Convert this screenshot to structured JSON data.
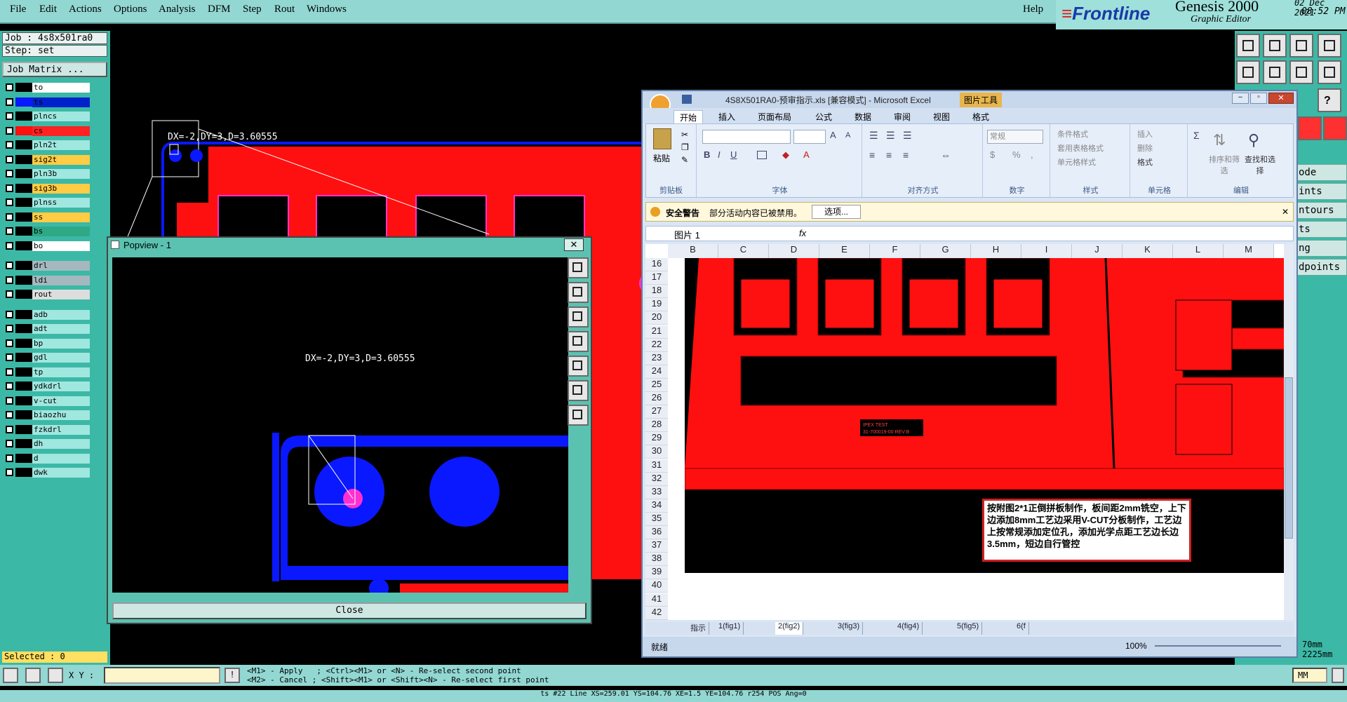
{
  "menu": [
    "File",
    "Edit",
    "Actions",
    "Options",
    "Analysis",
    "DFM",
    "Step",
    "Rout",
    "Windows",
    "Help"
  ],
  "brand": {
    "logo": "Frontline",
    "product": "Genesis 2000",
    "subtitle": "Graphic Editor",
    "date": "02 Dec 2021",
    "time": "08:52 PM"
  },
  "job": {
    "job_label": "Job : 4s8x501ra0",
    "step_label": "Step: set",
    "matrix_button": "Job Matrix ..."
  },
  "layers": [
    {
      "name": "to",
      "color": "#ffffff"
    },
    {
      "name": "ts",
      "color": "#0022cc",
      "active": true
    },
    {
      "name": "plncs",
      "color": "#a0e7df"
    },
    {
      "name": "cs",
      "color": "#ff2222"
    },
    {
      "name": "pln2t",
      "color": "#a0e7df"
    },
    {
      "name": "sig2t",
      "color": "#ffcc44"
    },
    {
      "name": "pln3b",
      "color": "#a0e7df"
    },
    {
      "name": "sig3b",
      "color": "#ffcc44"
    },
    {
      "name": "plnss",
      "color": "#a0e7df"
    },
    {
      "name": "ss",
      "color": "#ffcc44"
    },
    {
      "name": "bs",
      "color": "#2fa886"
    },
    {
      "name": "bo",
      "color": "#ffffff"
    },
    {
      "name": "drl",
      "color": "#a5b8c0"
    },
    {
      "name": "ldi",
      "color": "#a5b8c0"
    },
    {
      "name": "rout",
      "color": "#dddddd"
    },
    {
      "name": "adb",
      "color": "#a0e7df"
    },
    {
      "name": "adt",
      "color": "#a0e7df"
    },
    {
      "name": "bp",
      "color": "#a0e7df"
    },
    {
      "name": "gdl",
      "color": "#a0e7df"
    },
    {
      "name": "tp",
      "color": "#a0e7df"
    },
    {
      "name": "ydkdrl",
      "color": "#a0e7df"
    },
    {
      "name": "v-cut",
      "color": "#a0e7df"
    },
    {
      "name": "biaozhu",
      "color": "#a0e7df"
    },
    {
      "name": "fzkdrl",
      "color": "#a0e7df"
    },
    {
      "name": "dh",
      "color": "#a0e7df"
    },
    {
      "name": "d",
      "color": "#a0e7df"
    },
    {
      "name": "dwk",
      "color": "#a0e7df"
    }
  ],
  "selected": "Selected : 0",
  "measure": "DX=-2,DY=3,D=3.60555",
  "popview": {
    "title": "Popview - 1",
    "close": "Close"
  },
  "right_labels": [
    "ode",
    "ints",
    "ntours",
    "ts",
    "ng",
    "dpoints"
  ],
  "right_bottom": [
    "70mm",
    "2225mm"
  ],
  "bottom": {
    "xy_label": "X Y :",
    "hint1": "<M1> - Apply   ; <Ctrl><M1> or <N> - Re-select second point",
    "hint2": "<M2> - Cancel ; <Shift><M1> or <Shift><N> - Re-select first point",
    "units": "MM"
  },
  "status": "ts #22 Line XS=259.01 YS=104.76 XE=1.5 YE=104.76 r254 POS Ang=0",
  "excel": {
    "title": "4S8X501RA0-预审指示.xls  [兼容模式] - Microsoft Excel",
    "context_tab": "图片工具",
    "tabs": [
      "开始",
      "插入",
      "页面布局",
      "公式",
      "数据",
      "审阅",
      "视图",
      "格式"
    ],
    "groups": [
      "剪贴板",
      "字体",
      "对齐方式",
      "数字",
      "样式",
      "单元格",
      "编辑"
    ],
    "paste": "粘贴",
    "number_format": "常规",
    "style_items": [
      "条件格式",
      "套用表格格式",
      "单元格样式"
    ],
    "cell_items": [
      "插入",
      "删除",
      "格式"
    ],
    "edit_items": [
      "排序和筛选",
      "查找和选择"
    ],
    "security_title": "安全警告",
    "security_msg": "部分活动内容已被禁用。",
    "security_btn": "选项...",
    "namebox": "图片 1",
    "fx": "fx",
    "columns": [
      "B",
      "C",
      "D",
      "E",
      "F",
      "G",
      "H",
      "I",
      "J",
      "K",
      "L",
      "M"
    ],
    "rows": [
      "16",
      "17",
      "18",
      "19",
      "20",
      "21",
      "22",
      "23",
      "24",
      "25",
      "26",
      "27",
      "28",
      "29",
      "30",
      "31",
      "32",
      "33",
      "34",
      "35",
      "36",
      "37",
      "38",
      "39",
      "40",
      "41",
      "42"
    ],
    "sheets": [
      "指示",
      "1(fig1)",
      "2(fig2)",
      "3(fig3)",
      "4(fig4)",
      "5(fig5)",
      "6(f"
    ],
    "status": "就绪",
    "zoom": "100%",
    "label_line1": "IPEX TEST",
    "label_line2": "31-700019-00 REV:B",
    "note": "按附图2*1正倒拼板制作，板间距2mm铣空，上下边添加8mm工艺边采用V-CUT分板制作，工艺边上按常规添加定位孔，添加光学点距工艺边长边3.5mm，短边自行管控"
  },
  "colors": {
    "teal": "#3cb8a6",
    "menu": "#92d7d2",
    "pcb_red": "#ff1010",
    "pcb_blue": "#0a18ff",
    "magenta": "#ff30d0"
  }
}
